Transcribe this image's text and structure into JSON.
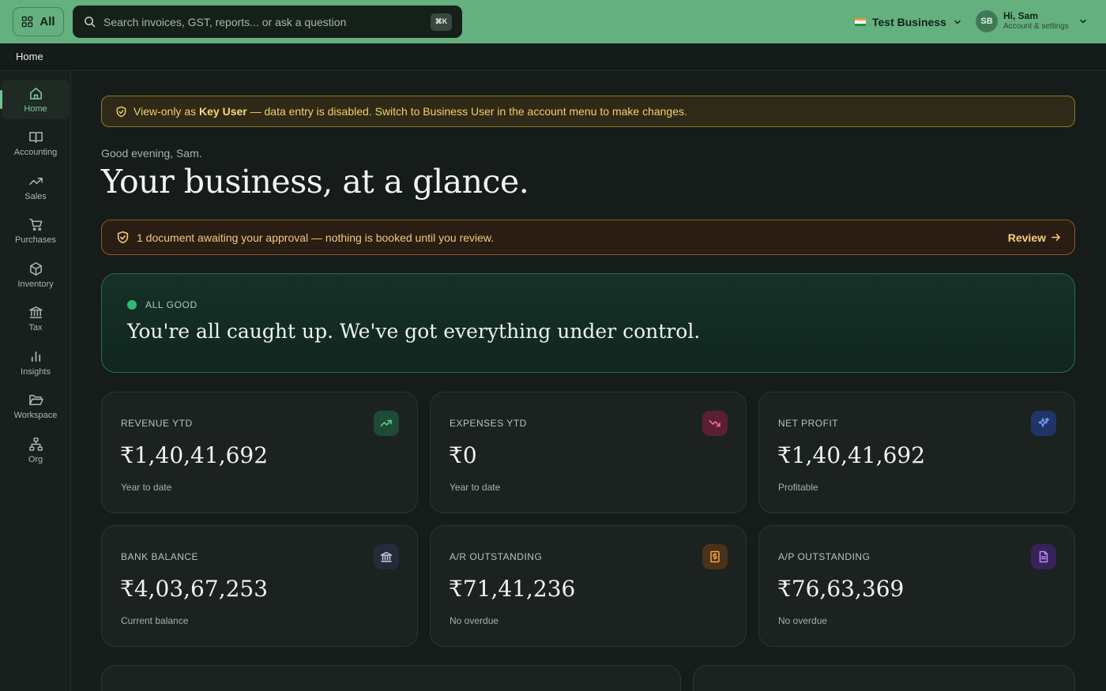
{
  "topbar": {
    "all_label": "All",
    "search_placeholder": "Search invoices, GST, reports... or ask a question",
    "search_shortcut": "⌘K",
    "business_name": "Test Business",
    "avatar_initials": "SB",
    "user_greeting": "Hi, Sam",
    "account_sub": "Account & settings"
  },
  "breadcrumb": {
    "current": "Home"
  },
  "sidebar": {
    "items": [
      {
        "label": "Home",
        "icon": "home-icon",
        "active": true
      },
      {
        "label": "Accounting",
        "icon": "book-icon"
      },
      {
        "label": "Sales",
        "icon": "trending-up-icon"
      },
      {
        "label": "Purchases",
        "icon": "cart-icon"
      },
      {
        "label": "Inventory",
        "icon": "box-icon"
      },
      {
        "label": "Tax",
        "icon": "bank-icon"
      },
      {
        "label": "Insights",
        "icon": "bar-chart-icon"
      },
      {
        "label": "Workspace",
        "icon": "folder-icon"
      },
      {
        "label": "Org",
        "icon": "org-chart-icon"
      }
    ]
  },
  "banner": {
    "prefix": "View-only as",
    "role": "Key User",
    "suffix": "— data entry is disabled. Switch to Business User in the account menu to make changes."
  },
  "greeting": "Good evening, Sam.",
  "headline": "Your business, at a glance.",
  "approval": {
    "message": "1 document awaiting your approval — nothing is booked until you review.",
    "action": "Review"
  },
  "status": {
    "label": "ALL GOOD",
    "message": "You're all caught up. We've got everything under control."
  },
  "kpis": [
    {
      "label": "REVENUE YTD",
      "value": "₹1,40,41,692",
      "sub": "Year to date",
      "icon": "trending-up-icon",
      "accent": "#4fd08a"
    },
    {
      "label": "EXPENSES YTD",
      "value": "₹0",
      "sub": "Year to date",
      "icon": "trending-down-icon",
      "accent": "#f06c8c"
    },
    {
      "label": "NET PROFIT",
      "value": "₹1,40,41,692",
      "sub": "Profitable",
      "icon": "sparkle-icon",
      "accent": "#6f9cf5"
    },
    {
      "label": "BANK BALANCE",
      "value": "₹4,03,67,253",
      "sub": "Current balance",
      "icon": "bank-icon",
      "accent": "#c9cde0"
    },
    {
      "label": "A/R OUTSTANDING",
      "value": "₹71,41,236",
      "sub": "No overdue",
      "icon": "receipt-icon",
      "accent": "#f0a83f"
    },
    {
      "label": "A/P OUTSTANDING",
      "value": "₹76,63,369",
      "sub": "No overdue",
      "icon": "document-icon",
      "accent": "#b88af2"
    }
  ],
  "colors": {
    "topbar": "#64b07f",
    "background": "#151c19",
    "success": "#2fba74",
    "warning": "#f0cf6a"
  }
}
